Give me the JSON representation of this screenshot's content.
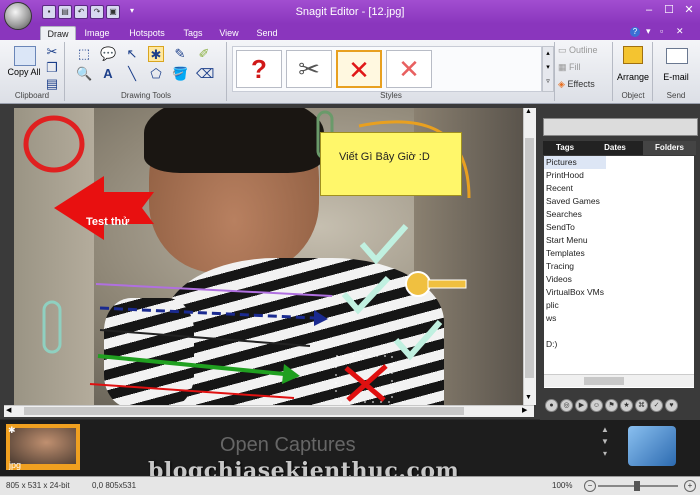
{
  "title_bar": {
    "title": "Snagit Editor - [12.jpg]",
    "minimize": "–",
    "maximize": "☐",
    "close": "✕"
  },
  "ribbon_tabs": [
    "Draw",
    "Image",
    "Hotspots",
    "Tags",
    "View",
    "Send"
  ],
  "clipboard": {
    "copy_all_label": "Copy All",
    "group_label": "Clipboard"
  },
  "drawing_tools": {
    "group_label": "Drawing Tools"
  },
  "styles": {
    "group_label": "Styles"
  },
  "style_options": {
    "outline": "Outline",
    "fill": "Fill",
    "effects": "Effects"
  },
  "object": {
    "arrange": "Arrange",
    "group_label": "Object"
  },
  "send": {
    "email": "E-mail",
    "group_label": "Send"
  },
  "annotations": {
    "callout_text": "Viết Gì Bây Giờ :D",
    "arrow_text": "Test thử"
  },
  "library_tabs": [
    "Tags",
    "Dates",
    "Folders"
  ],
  "folders": [
    "Pictures",
    "PrintHood",
    "Recent",
    "Saved Games",
    "Searches",
    "SendTo",
    "Start Menu",
    "Templates",
    "Tracing",
    "Videos",
    "VirtualBox VMs",
    "plic",
    "ws",
    "",
    "D:)"
  ],
  "tray": {
    "open_captures": "Open Captures",
    "thumb_label": "jpg",
    "watermark": "blogchiasekienthuc.com"
  },
  "status": {
    "size": "805 x 531 x 24-bit",
    "coords": "0,0  805x531",
    "zoom": "100%"
  },
  "colors": {
    "titlebar": "#9a45c8",
    "accent_orange": "#e8a020",
    "arrow_red": "#e81010"
  }
}
